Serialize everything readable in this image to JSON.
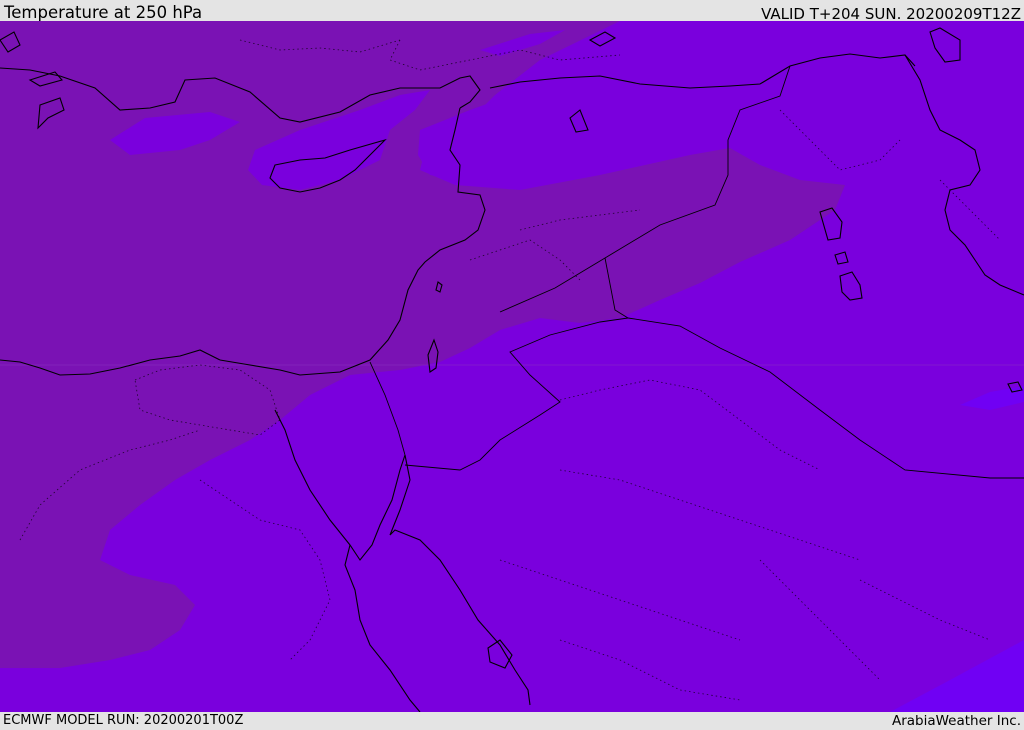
{
  "header": {
    "title": "Temperature at 250 hPa",
    "valid": "VALID T+204 SUN. 20200209T12Z"
  },
  "footer": {
    "model_run": "ECMWF MODEL RUN: 20200201T00Z",
    "credit": "ArabiaWeather Inc."
  },
  "colors": {
    "background_field": "#7a00dd",
    "colder_field": "#7a12b4",
    "warmer_patch": "#7000f4",
    "coastline": "#000000",
    "page_bars": "#e4e4e4"
  },
  "map": {
    "region": "Eastern Mediterranean / Middle East",
    "field": "temperature",
    "level_hpa": 250,
    "features": [
      "coastlines",
      "country-borders",
      "dotted-province-borders"
    ]
  }
}
